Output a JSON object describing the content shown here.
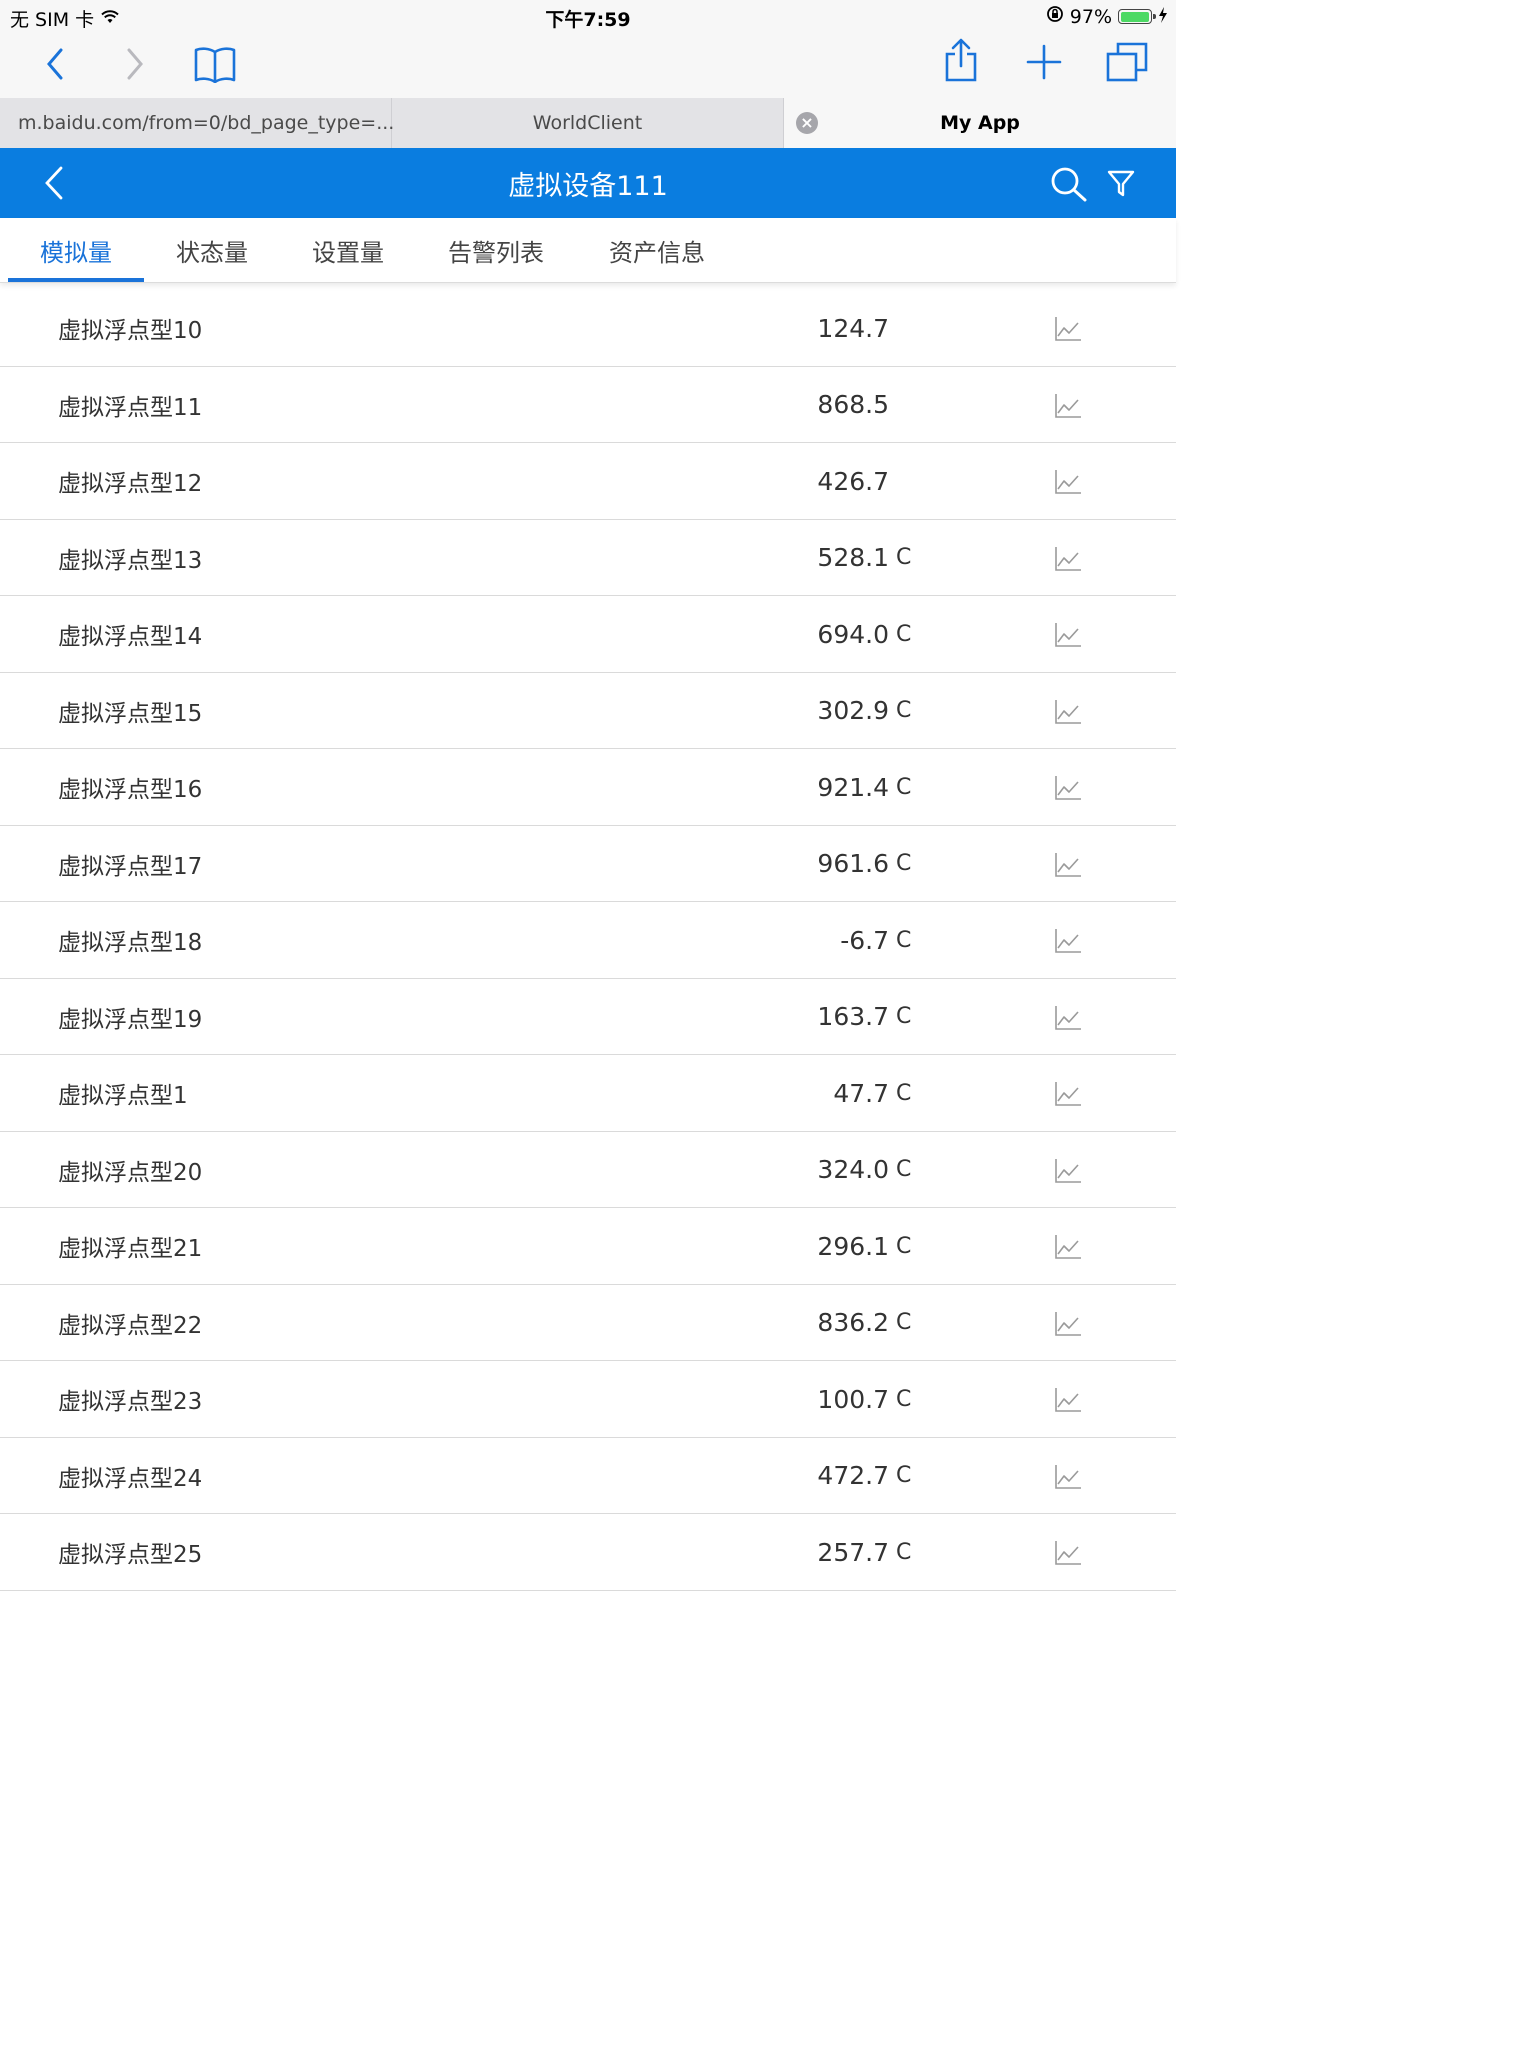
{
  "status_bar": {
    "carrier": "无 SIM 卡",
    "time": "下午7:59",
    "battery_percent": "97%",
    "battery_level": 0.97
  },
  "browser_tabs": [
    {
      "label": "m.baidu.com/from=0/bd_page_type=..."
    },
    {
      "label": "WorldClient"
    },
    {
      "label": "My App"
    }
  ],
  "header": {
    "title": "虚拟设备111"
  },
  "sub_tabs": [
    {
      "label": "模拟量",
      "active": true
    },
    {
      "label": "状态量"
    },
    {
      "label": "设置量"
    },
    {
      "label": "告警列表"
    },
    {
      "label": "资产信息"
    }
  ],
  "rows": [
    {
      "name": "虚拟浮点型10",
      "value": "124.7",
      "unit": ""
    },
    {
      "name": "虚拟浮点型11",
      "value": "868.5",
      "unit": ""
    },
    {
      "name": "虚拟浮点型12",
      "value": "426.7",
      "unit": ""
    },
    {
      "name": "虚拟浮点型13",
      "value": "528.1",
      "unit": "C"
    },
    {
      "name": "虚拟浮点型14",
      "value": "694.0",
      "unit": "C"
    },
    {
      "name": "虚拟浮点型15",
      "value": "302.9",
      "unit": "C"
    },
    {
      "name": "虚拟浮点型16",
      "value": "921.4",
      "unit": "C"
    },
    {
      "name": "虚拟浮点型17",
      "value": "961.6",
      "unit": "C"
    },
    {
      "name": "虚拟浮点型18",
      "value": "-6.7",
      "unit": "C"
    },
    {
      "name": "虚拟浮点型19",
      "value": "163.7",
      "unit": "C"
    },
    {
      "name": "虚拟浮点型1",
      "value": "47.7",
      "unit": "C"
    },
    {
      "name": "虚拟浮点型20",
      "value": "324.0",
      "unit": "C"
    },
    {
      "name": "虚拟浮点型21",
      "value": "296.1",
      "unit": "C"
    },
    {
      "name": "虚拟浮点型22",
      "value": "836.2",
      "unit": "C"
    },
    {
      "name": "虚拟浮点型23",
      "value": "100.7",
      "unit": "C"
    },
    {
      "name": "虚拟浮点型24",
      "value": "472.7",
      "unit": "C"
    },
    {
      "name": "虚拟浮点型25",
      "value": "257.7",
      "unit": "C"
    }
  ]
}
